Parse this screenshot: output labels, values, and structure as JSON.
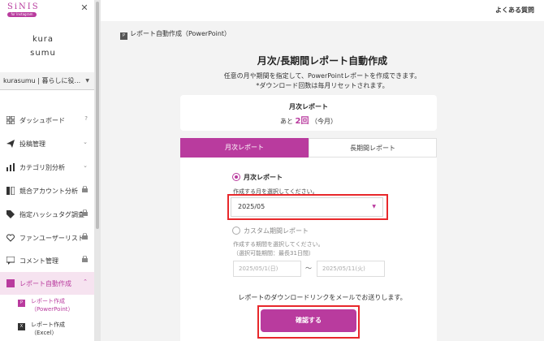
{
  "brand": {
    "logo_text": "SiNIS",
    "logo_tag": "for Instagram",
    "account_logo_line1": "kura",
    "account_logo_line2": "sumu"
  },
  "account": {
    "name": "kurasumu | 暮らしに役..."
  },
  "sidebar": {
    "items": [
      {
        "label": "ダッシュボード",
        "icon": "dashboard-icon",
        "right": "?"
      },
      {
        "label": "投稿管理",
        "icon": "send-icon",
        "right": "⌄"
      },
      {
        "label": "カテゴリ別分析",
        "icon": "bar-chart-icon",
        "right": "⌄"
      },
      {
        "label": "競合アカウント分析",
        "icon": "compare-icon",
        "right": "🔒"
      },
      {
        "label": "指定ハッシュタグ調査",
        "icon": "tag-icon",
        "right": "🔒"
      },
      {
        "label": "ファンユーザーリスト",
        "icon": "heart-icon",
        "right": "🔒"
      },
      {
        "label": "コメント管理",
        "icon": "comment-icon",
        "right": "🔒"
      },
      {
        "label": "レポート自動作成",
        "icon": "report-icon",
        "right": "⌃"
      }
    ],
    "sub_items": [
      {
        "line1": "レポート作成",
        "line2": "（PowerPoint）",
        "icon_letter": "P"
      },
      {
        "line1": "レポート作成",
        "line2": "（Excel）",
        "icon_letter": "X"
      }
    ]
  },
  "header": {
    "faq": "よくある質問"
  },
  "breadcrumb": {
    "label": "レポート自動作成（PowerPoint）"
  },
  "main": {
    "title": "月次/長期間レポート自動作成",
    "desc_line1": "任意の月や期間を指定して、PowerPointレポートを作成できます。",
    "desc_line2": "*ダウンロード回数は毎月リセットされます。"
  },
  "info_card": {
    "title": "月次レポート",
    "prefix": "あと",
    "count": "2回",
    "suffix": "（今月）"
  },
  "tabs": [
    {
      "label": "月次レポート",
      "active": true
    },
    {
      "label": "長期間レポート",
      "active": false
    }
  ],
  "form": {
    "monthly_label": "月次レポート",
    "month_hint": "作成する月を選択してください。",
    "month_value": "2025/05",
    "custom_label": "カスタム期間レポート",
    "period_hint": "作成する期間を選択してください。",
    "period_note": "（選択可能期間：最長31日間）",
    "start_placeholder": "2025/05/1(日)",
    "end_placeholder": "2025/05/11(火)",
    "separator": "～"
  },
  "footer": {
    "mail_text": "レポートのダウンロードリンクをメールでお送りします。",
    "confirm_label": "確認する"
  },
  "colors": {
    "accent": "#b93b9e",
    "highlight": "#e8282b"
  }
}
